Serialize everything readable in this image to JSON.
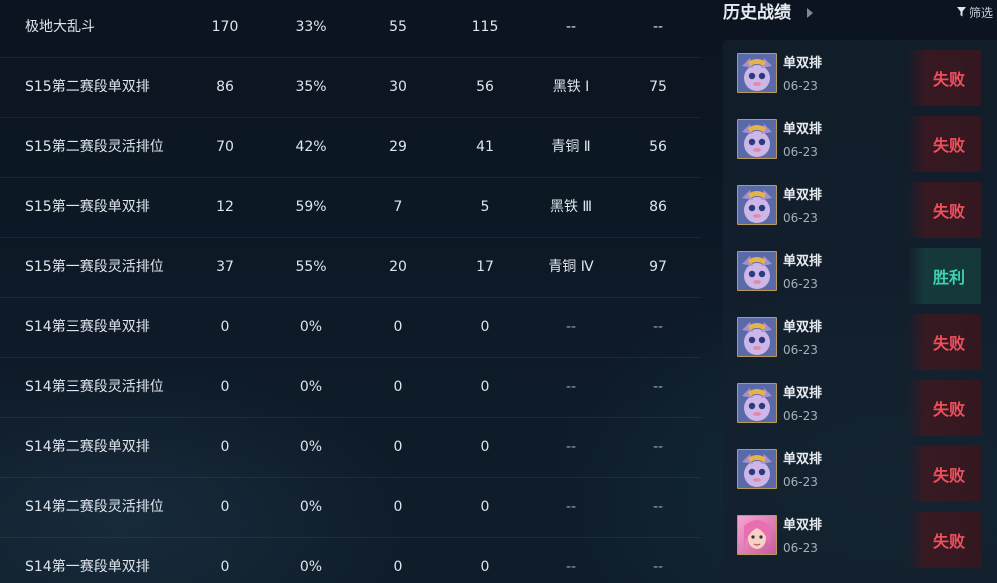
{
  "stats": {
    "rows": [
      {
        "name": "极地大乱斗",
        "c1": "170",
        "c2": "33%",
        "c3": "55",
        "c4": "115",
        "rank": "--",
        "c6": "--"
      },
      {
        "name": "S15第二赛段单双排",
        "c1": "86",
        "c2": "35%",
        "c3": "30",
        "c4": "56",
        "rank": "黑铁 Ⅰ",
        "c6": "75"
      },
      {
        "name": "S15第二赛段灵活排位",
        "c1": "70",
        "c2": "42%",
        "c3": "29",
        "c4": "41",
        "rank": "青铜 Ⅱ",
        "c6": "56"
      },
      {
        "name": "S15第一赛段单双排",
        "c1": "12",
        "c2": "59%",
        "c3": "7",
        "c4": "5",
        "rank": "黑铁 Ⅲ",
        "c6": "86"
      },
      {
        "name": "S15第一赛段灵活排位",
        "c1": "37",
        "c2": "55%",
        "c3": "20",
        "c4": "17",
        "rank": "青铜 Ⅳ",
        "c6": "97"
      },
      {
        "name": "S14第三赛段单双排",
        "c1": "0",
        "c2": "0%",
        "c3": "0",
        "c4": "0",
        "rank": "--",
        "c6": "--"
      },
      {
        "name": "S14第三赛段灵活排位",
        "c1": "0",
        "c2": "0%",
        "c3": "0",
        "c4": "0",
        "rank": "--",
        "c6": "--"
      },
      {
        "name": "S14第二赛段单双排",
        "c1": "0",
        "c2": "0%",
        "c3": "0",
        "c4": "0",
        "rank": "--",
        "c6": "--"
      },
      {
        "name": "S14第二赛段灵活排位",
        "c1": "0",
        "c2": "0%",
        "c3": "0",
        "c4": "0",
        "rank": "--",
        "c6": "--"
      },
      {
        "name": "S14第一赛段单双排",
        "c1": "0",
        "c2": "0%",
        "c3": "0",
        "c4": "0",
        "rank": "--",
        "c6": "--"
      }
    ]
  },
  "history": {
    "title": "历史战绩",
    "filter_label": "筛选",
    "matches": [
      {
        "mode": "单双排",
        "date": "06-23",
        "result": "失败",
        "outcome": "lose",
        "champion_icon": "yuumi-icon"
      },
      {
        "mode": "单双排",
        "date": "06-23",
        "result": "失败",
        "outcome": "lose",
        "champion_icon": "yuumi-icon"
      },
      {
        "mode": "单双排",
        "date": "06-23",
        "result": "失败",
        "outcome": "lose",
        "champion_icon": "yuumi-icon"
      },
      {
        "mode": "单双排",
        "date": "06-23",
        "result": "胜利",
        "outcome": "win",
        "champion_icon": "yuumi-icon"
      },
      {
        "mode": "单双排",
        "date": "06-23",
        "result": "失败",
        "outcome": "lose",
        "champion_icon": "yuumi-icon"
      },
      {
        "mode": "单双排",
        "date": "06-23",
        "result": "失败",
        "outcome": "lose",
        "champion_icon": "yuumi-icon"
      },
      {
        "mode": "单双排",
        "date": "06-23",
        "result": "失败",
        "outcome": "lose",
        "champion_icon": "yuumi-icon"
      },
      {
        "mode": "单双排",
        "date": "06-23",
        "result": "失败",
        "outcome": "lose",
        "champion_icon": "seraphine-icon"
      }
    ]
  },
  "colors": {
    "lose": "#f0505e",
    "win": "#3fd0b4",
    "avatar_border": "#b99a5b"
  }
}
